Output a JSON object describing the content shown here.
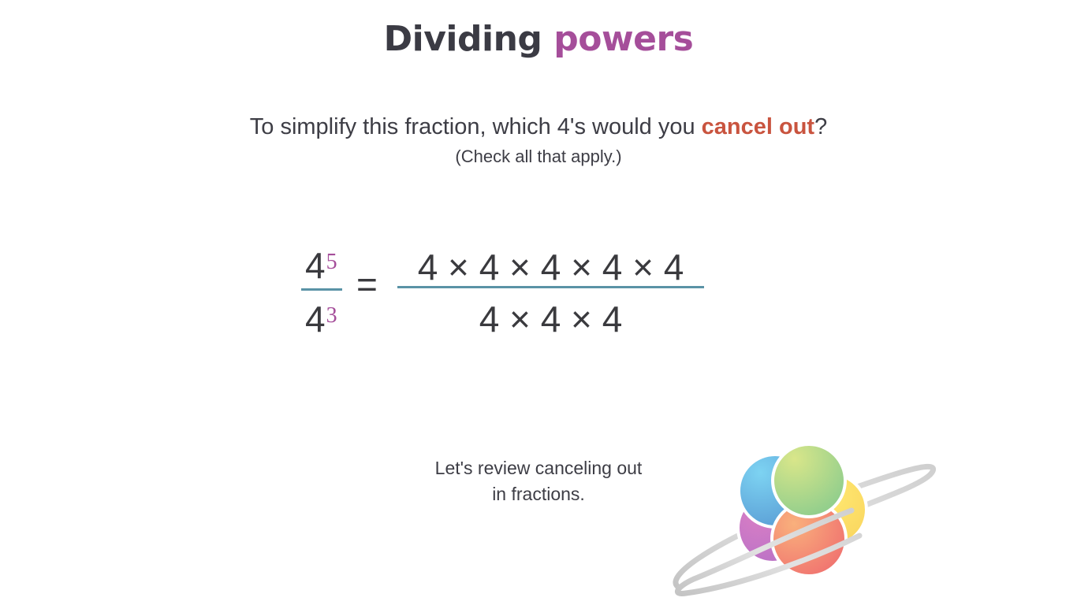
{
  "header": {
    "title_part1": "Dividing",
    "title_part2": "powers"
  },
  "prompt": {
    "question_before": "To simplify this fraction, which 4's would you ",
    "question_emphasis": "cancel out",
    "question_after": "?",
    "hint": "(Check all that apply.)"
  },
  "equation": {
    "left_numerator_base": "4",
    "left_numerator_exponent": "5",
    "left_denominator_base": "4",
    "left_denominator_exponent": "3",
    "equals": "=",
    "right_numerator": "4 × 4 × 4 × 4 × 4",
    "right_denominator": "4 × 4 × 4"
  },
  "review": {
    "line1": "Let's review canceling out",
    "line2": "in fractions."
  },
  "colors": {
    "title_accent": "#a54e9a",
    "emphasis": "#c9543f",
    "fraction_bar": "#5a93a6",
    "exponent": "#a54e9a",
    "text": "#3d3d45"
  },
  "logo": {
    "icon": "planet-logo-icon"
  }
}
